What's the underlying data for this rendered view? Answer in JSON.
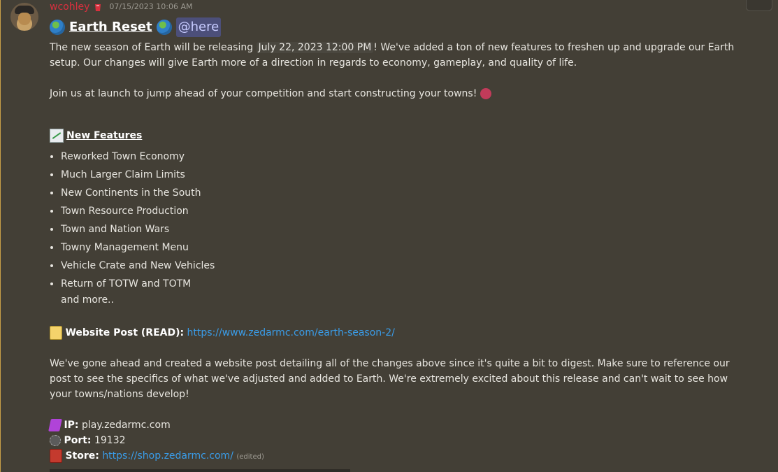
{
  "message": {
    "author": "wcohley",
    "timestamp": "07/15/2023 10:06 AM",
    "title": "Earth Reset",
    "mention": "@here",
    "intro_before": "The new season of Earth will be releasing ",
    "release_time": "July 22, 2023 12:00 PM",
    "intro_after": "! We've added a ton of new features to freshen up and upgrade our Earth setup. Our changes will give Earth more of a direction in regards to economy, gameplay, and quality of life.",
    "join_text": "Join us at launch to jump ahead of your competition and start constructing your towns!",
    "features_heading": "New Features",
    "features": [
      "Reworked Town Economy",
      "Much Larger Claim Limits",
      "New Continents in the South",
      "Town Resource Production",
      "Town and Nation Wars",
      "Towny Management Menu",
      "Vehicle Crate and New Vehicles",
      "Return of TOTW and TOTM"
    ],
    "features_more": "and more..",
    "website_label": "Website Post (READ):",
    "website_url": "https://www.zedarmc.com/earth-season-2/",
    "website_paragraph": "We've gone ahead and created a website post detailing all of the changes above since it's quite a bit to digest. Make sure to reference our post to see the specifics of what we've adjusted and added to Earth. We're extremely excited about this release and can't wait to see how your towns/nations develop!",
    "ip_label": "IP:",
    "ip_value": "play.zedarmc.com",
    "port_label": "Port:",
    "port_value": "19132",
    "store_label": "Store:",
    "store_url": "https://shop.zedarmc.com/",
    "edited": "(edited)"
  },
  "icons": {
    "author_badge": "red-diamond-icon",
    "title_left": "globe-icon",
    "title_right": "globe-icon",
    "join_emoji": "character-emoji-icon",
    "features_emoji": "chart-increasing-icon",
    "website_emoji": "memo-icon",
    "ip_emoji": "purple-crystal-icon",
    "port_emoji": "gear-icon",
    "store_emoji": "chest-icon"
  },
  "colors": {
    "background": "#433f36",
    "username": "#d8303e",
    "link": "#3a9ce8",
    "mention_bg": "#4c4f7a"
  }
}
